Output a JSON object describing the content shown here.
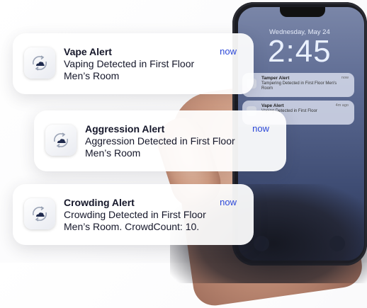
{
  "lockscreen": {
    "date": "Wednesday, May 24",
    "time": "2:45",
    "notifications": [
      {
        "title": "Tamper Alert",
        "body": "Tampering Detected in First Floor Men's Room",
        "time": "now"
      },
      {
        "title": "Vape Alert",
        "body": "Vaping Detected in First Floor",
        "time": "4m ago"
      }
    ]
  },
  "cards": [
    {
      "title": "Vape Alert",
      "body": "Vaping Detected in First Floor Men’s Room",
      "time": "now"
    },
    {
      "title": "Aggression Alert",
      "body": "Aggression Detected in First Floor Men’s Room",
      "time": "now"
    },
    {
      "title": "Crowding Alert",
      "body": "Crowding Detected in First Floor Men’s Room. CrowdCount: 10.",
      "time": "now"
    }
  ],
  "colors": {
    "accent": "#2b47d8",
    "text": "#15172a"
  },
  "icons": {
    "app": "cloud-sync-icon"
  }
}
